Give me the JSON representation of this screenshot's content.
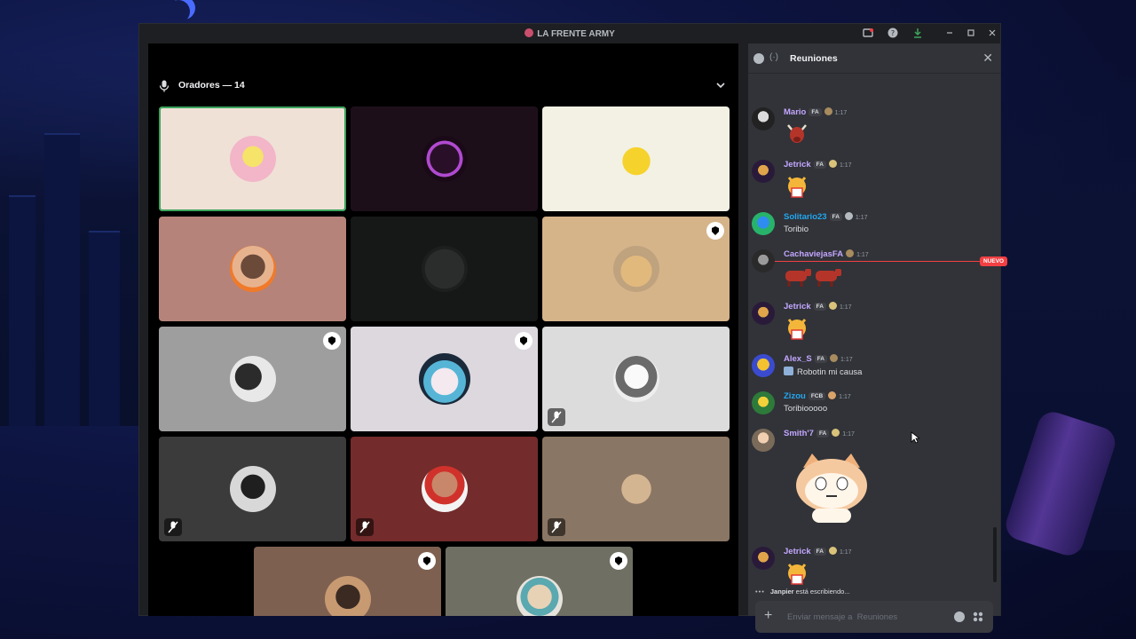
{
  "window": {
    "title": "LA FRENTE ARMY"
  },
  "stage": {
    "header_label": "Oradores — 14"
  },
  "chat": {
    "channel_name": "Reuniones",
    "new_marker": "NUEVO",
    "messages": [
      {
        "user": "Mario",
        "color": "#c3a6ff",
        "tag": "FA",
        "time": "1:17",
        "text": ""
      },
      {
        "user": "Jetrick",
        "color": "#c3a6ff",
        "tag": "FA",
        "time": "1:17",
        "text": ""
      },
      {
        "user": "Solitario23",
        "color": "#23a7f0",
        "tag": "FA",
        "time": "1:17",
        "text": "Toribio"
      },
      {
        "user": "CachaviejasFA",
        "color": "#c3a6ff",
        "tag": "",
        "time": "1:17",
        "text": ""
      },
      {
        "user": "Jetrick",
        "color": "#c3a6ff",
        "tag": "FA",
        "time": "1:17",
        "text": ""
      },
      {
        "user": "Alex_S",
        "color": "#c3a6ff",
        "tag": "FA",
        "time": "1:17",
        "text": "Robotin mi causa"
      },
      {
        "user": "Zizou",
        "color": "#23a7f0",
        "tag": "FCB",
        "time": "1:17",
        "text": "Toribiooooo"
      },
      {
        "user": "Smith'7",
        "color": "#c3a6ff",
        "tag": "FA",
        "time": "1:17",
        "text": ""
      },
      {
        "user": "Jetrick",
        "color": "#c3a6ff",
        "tag": "FA",
        "time": "1:17",
        "text": ""
      }
    ],
    "typing": {
      "user": "Janpier",
      "suffix": "está escribiendo..."
    },
    "composer_placeholder": "Enviar mensaje a  Reuniones"
  },
  "colors": {
    "accent_speaking": "#3ba55d",
    "new_divider": "#f23f43",
    "chat_bg": "#313338"
  }
}
